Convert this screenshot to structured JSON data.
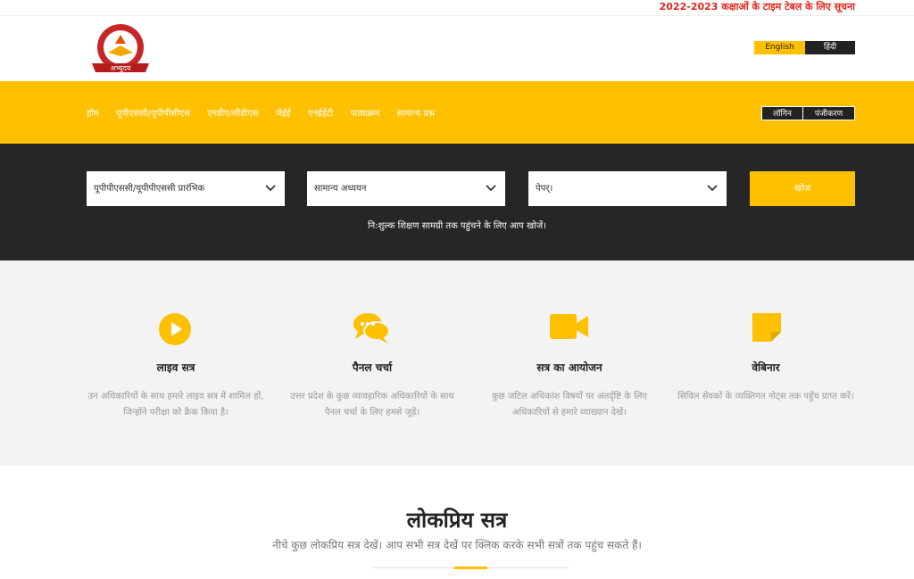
{
  "ticker": {
    "text": "2022-2023 कक्षाओं के टाइम टेबल के लिए सूचना"
  },
  "header": {
    "logo_text": "अभ्युदय",
    "lang_en": "English",
    "lang_hi": "हिंदी"
  },
  "nav": {
    "items": [
      "होम",
      "यूपीएससी/यूपीपीसीएस",
      "एनडीए/सीडीएस",
      "जेईई",
      "एनईईटी",
      "पाठ्यक्रम",
      "सामान्य प्रश्न"
    ],
    "login": "लॉगिन",
    "register": "पंजीकरण"
  },
  "search": {
    "select1": "यूपीपीएससी/यूपीपीएससी प्रारंभिक",
    "select2": "सामान्य अध्ययन",
    "select3": "पेपर्।",
    "button": "खोज",
    "hint": "नि:शुल्क शिक्षण सामग्री तक पहुंचने के लिए आप खोजें।"
  },
  "features": [
    {
      "icon": "play-icon",
      "title": "लाइव सत्र",
      "desc": "उन अधिकारियों के साथ हमारे लाइव सत्र में शामिल हों, जिन्होंने परीक्षा को क्रैक किया है।"
    },
    {
      "icon": "chat-icon",
      "title": "पैनल चर्चा",
      "desc": "उत्तर प्रदेश के कुछ व्यावहारिक अधिकारियों के साथ पैनल चर्चा के लिए हमसे जुड़ें।"
    },
    {
      "icon": "video-icon",
      "title": "सत्र का आयोजन",
      "desc": "कुछ जटिल अधिकांश विषयों पर अंतर्दृष्टि के लिए अधिकारियों से हमारे व्याख्यान देखें।"
    },
    {
      "icon": "note-icon",
      "title": "वेबिनार",
      "desc": "सिविल सेवकों के व्यक्तिगत नोट्स तक पहुँच प्राप्त करें।"
    }
  ],
  "popular": {
    "title": "लोकप्रिय सत्र",
    "subtitle": "नीचे कुछ लोकप्रिय सत्र देखें। आप सभी सत्र देखें पर क्लिक करके सभी सत्रों तक पहुंच सकते हैं।"
  },
  "colors": {
    "accent": "#ffc000",
    "dark": "#262626",
    "ticker": "#e1251b"
  }
}
